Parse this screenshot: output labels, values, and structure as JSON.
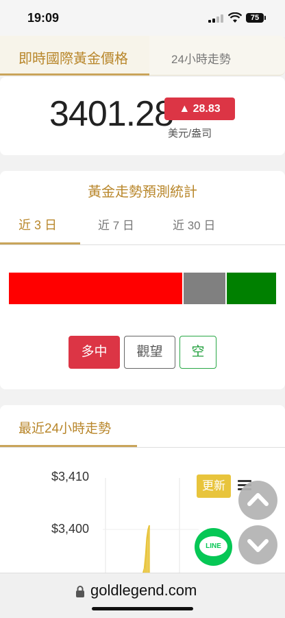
{
  "status_bar": {
    "time": "19:09",
    "battery": "75"
  },
  "top_tabs": {
    "active_label": "即時國際黃金價格",
    "second_label": "24小時走勢"
  },
  "price": {
    "value": "3401.28",
    "change": "▲ 28.83",
    "unit": "美元/盎司"
  },
  "stats": {
    "title": "黃金走勢預測統計",
    "periods": [
      "近 3 日",
      "近 7 日",
      "近 30 日"
    ],
    "active_period": "近 3 日",
    "distribution": [
      {
        "label": "多中",
        "fraction": 0.655,
        "color": "#ff0000"
      },
      {
        "label": "觀望",
        "fraction": 0.16,
        "color": "#808080"
      },
      {
        "label": "空",
        "fraction": 0.185,
        "color": "#008000"
      }
    ],
    "buttons": {
      "bull": "多中",
      "neutral": "觀望",
      "bear": "空"
    }
  },
  "trend": {
    "title": "最近24小時走勢",
    "update_label": "更新",
    "line_label": "LINE"
  },
  "chart_data": {
    "type": "line",
    "title": "",
    "xlabel": "",
    "ylabel": "",
    "y_ticks": [
      "$3,410",
      "$3,400"
    ],
    "ylim": [
      3390,
      3412
    ],
    "series": [
      {
        "values": [
          3390,
          3391,
          3394,
          3398,
          3400,
          3401
        ]
      }
    ]
  },
  "browser": {
    "url": "goldlegend.com"
  },
  "colors": {
    "gold": "#b8862a",
    "red": "#dc3545",
    "green": "#28a745",
    "line_green": "#06c755",
    "update_yellow": "#e8c43c"
  }
}
